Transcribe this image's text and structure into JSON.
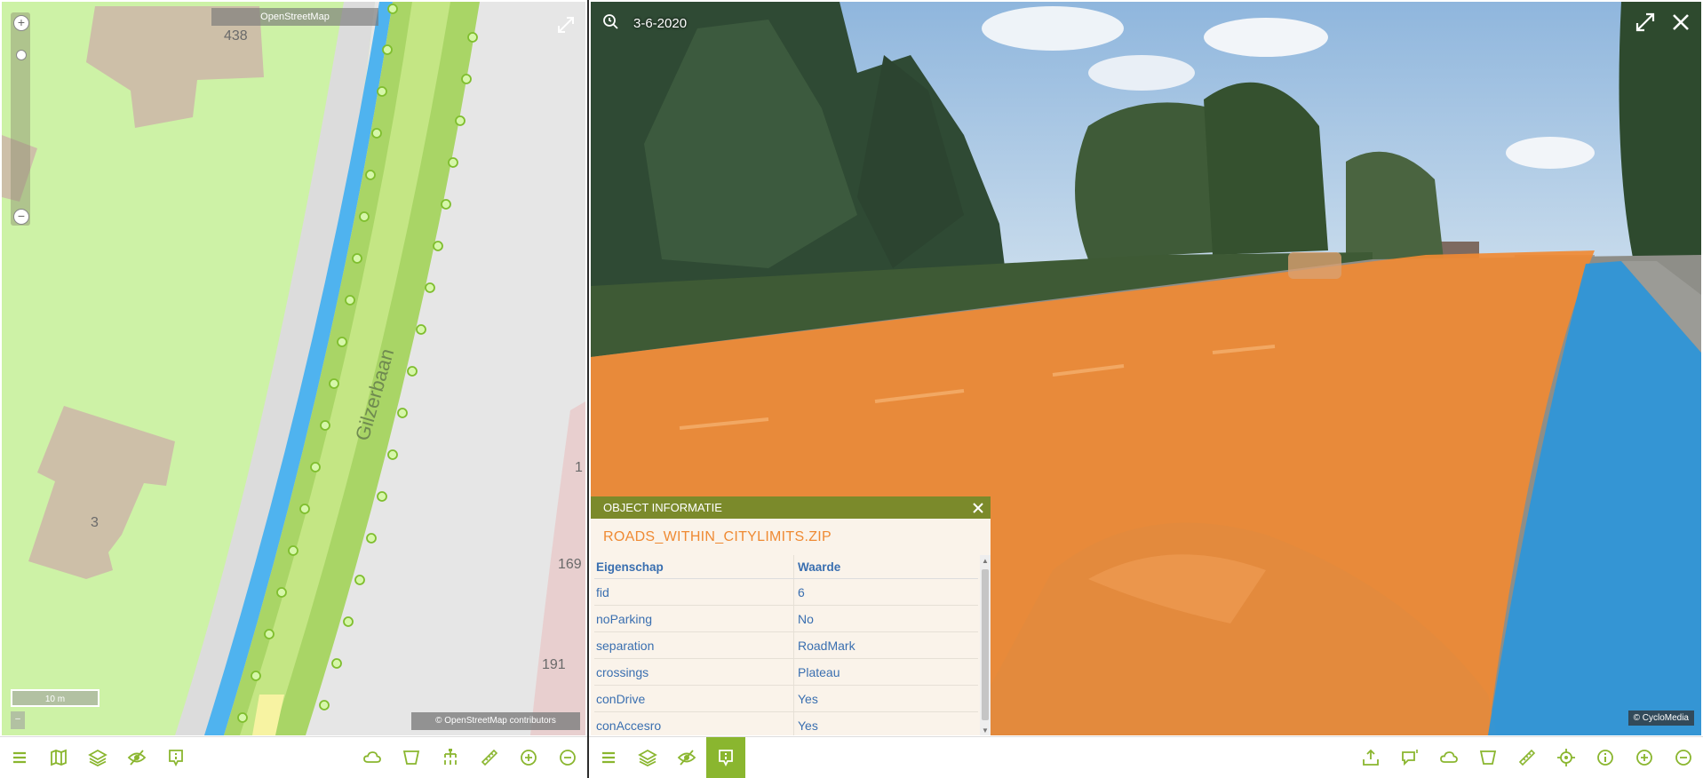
{
  "map": {
    "tile_source": "OpenStreetMap",
    "street_name": "Gilzerbaan",
    "house_numbers": [
      "438",
      "3",
      "1",
      "169",
      "191"
    ],
    "scale_label": "10 m",
    "scale_small": "–",
    "attribution": "© OpenStreetMap contributors",
    "zoom_in": "+",
    "zoom_out": "−"
  },
  "pano": {
    "date": "3-6-2020",
    "copyright": "© CycloMedia"
  },
  "object_info": {
    "header": "OBJECT INFORMATIE",
    "title": "ROADS_WITHIN_CITYLIMITS.ZIP",
    "col_property": "Eigenschap",
    "col_value": "Waarde",
    "rows": [
      {
        "key": "fid",
        "value": "6"
      },
      {
        "key": "noParking",
        "value": "No"
      },
      {
        "key": "separation",
        "value": "RoadMark"
      },
      {
        "key": "crossings",
        "value": "Plateau"
      },
      {
        "key": "conDrive",
        "value": "Yes"
      },
      {
        "key": "conAccesro",
        "value": "Yes"
      }
    ]
  },
  "toolbars": {
    "map_left": [
      "menu-icon",
      "map-icon",
      "layers-icon",
      "visibility-off-icon",
      "info-pin-icon"
    ],
    "map_right": [
      "cloud-icon",
      "polygon-icon",
      "tree-icon",
      "measure-icon",
      "zoom-in-icon",
      "zoom-out-icon"
    ],
    "pano_left": [
      "menu-icon",
      "layers-icon",
      "visibility-off-icon",
      "info-pin-icon"
    ],
    "pano_right": [
      "upload-icon",
      "comment-icon",
      "cloud-icon",
      "polygon-icon",
      "measure-icon",
      "locate-icon",
      "info-icon",
      "zoom-in-icon",
      "zoom-out-icon"
    ]
  },
  "colors": {
    "accent": "#8ab62f",
    "panel_header": "#7b8a2b",
    "road_overlay": "#f08a33",
    "bike_overlay": "#2f96d8",
    "text_blue": "#3a6fb0"
  }
}
